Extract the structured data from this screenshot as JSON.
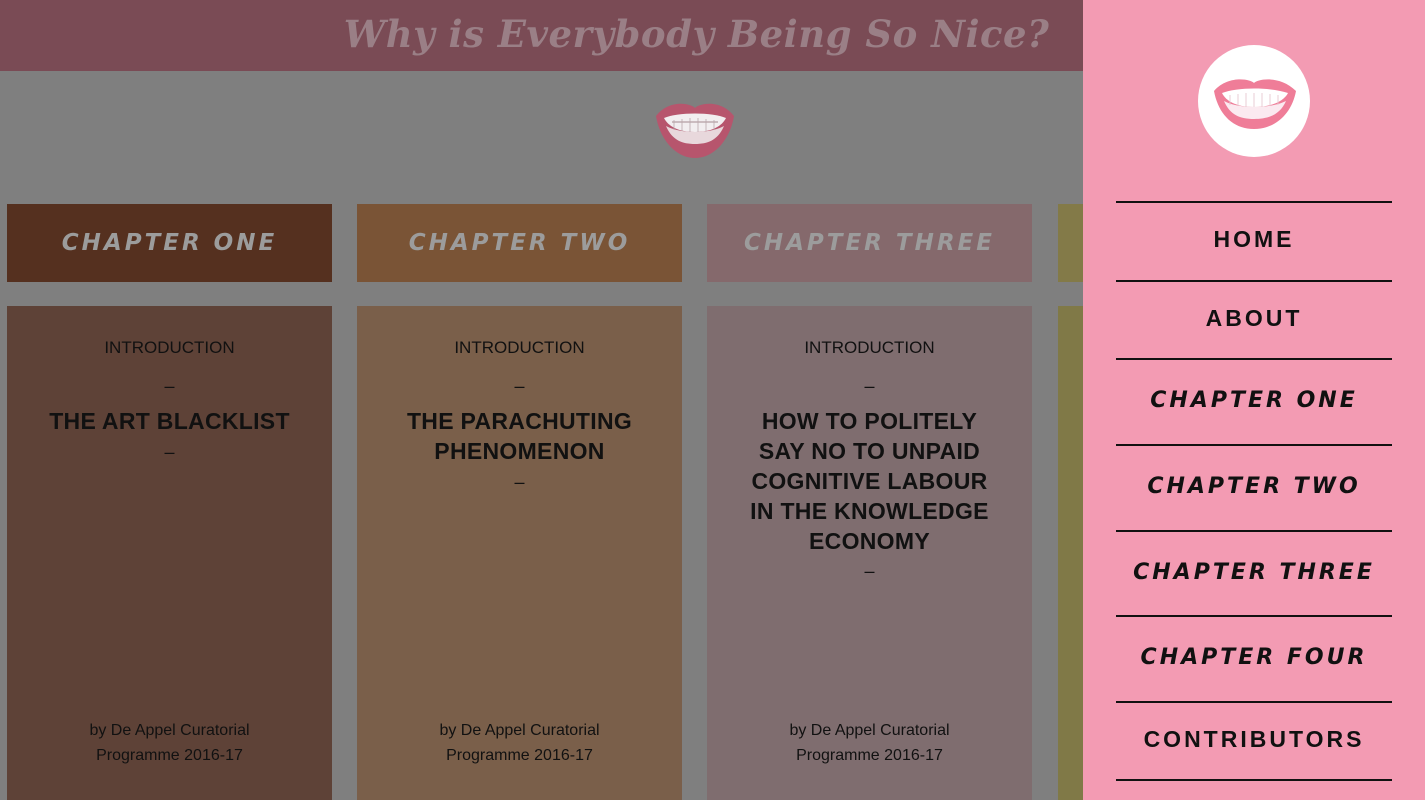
{
  "site": {
    "title": "Why is Everybody Being So Nice?"
  },
  "chapter_tabs": [
    {
      "label": "CHAPTER ONE",
      "color": "#55301f"
    },
    {
      "label": "CHAPTER TWO",
      "color": "#7a5436"
    },
    {
      "label": "CHAPTER THREE",
      "color": "#85696c"
    },
    {
      "label": "",
      "color": "#837a48"
    }
  ],
  "cards": [
    {
      "kicker": "INTRODUCTION",
      "dash": "–",
      "title_lines": [
        "THE ART BLACKLIST"
      ],
      "byline_lines": [
        "by De Appel Curatorial",
        "Programme 2016-17"
      ],
      "color": "#5e4237"
    },
    {
      "kicker": "INTRODUCTION",
      "dash": "–",
      "title_lines": [
        "THE PARACHUTING",
        "PHENOMENON"
      ],
      "byline_lines": [
        "by De Appel Curatorial",
        "Programme 2016-17"
      ],
      "color": "#7a5f4a"
    },
    {
      "kicker": "INTRODUCTION",
      "dash": "–",
      "title_lines": [
        "HOW TO POLITELY",
        "SAY NO TO UNPAID",
        "COGNITIVE LABOUR",
        "IN THE KNOWLEDGE",
        "ECONOMY"
      ],
      "byline_lines": [
        "by De Appel Curatorial",
        "Programme 2016-17"
      ],
      "color": "#7f6d6f"
    },
    {
      "color": "#807947"
    }
  ],
  "side_nav": {
    "items": [
      {
        "label": "HOME",
        "style": "plain"
      },
      {
        "label": "ABOUT",
        "style": "plain"
      },
      {
        "label": "CHAPTER ONE",
        "style": "chapter"
      },
      {
        "label": "CHAPTER TWO",
        "style": "chapter"
      },
      {
        "label": "CHAPTER THREE",
        "style": "chapter"
      },
      {
        "label": "CHAPTER FOUR",
        "style": "chapter"
      },
      {
        "label": "CONTRIBUTORS",
        "style": "plain"
      }
    ]
  },
  "colors": {
    "page_background": "#7f7f7f",
    "header_background": "#7a4b55",
    "side_panel_background": "#f39bb3",
    "title_text": "#9a7f86"
  },
  "icons": {
    "logo": "smiling-mouth-logo-icon"
  }
}
